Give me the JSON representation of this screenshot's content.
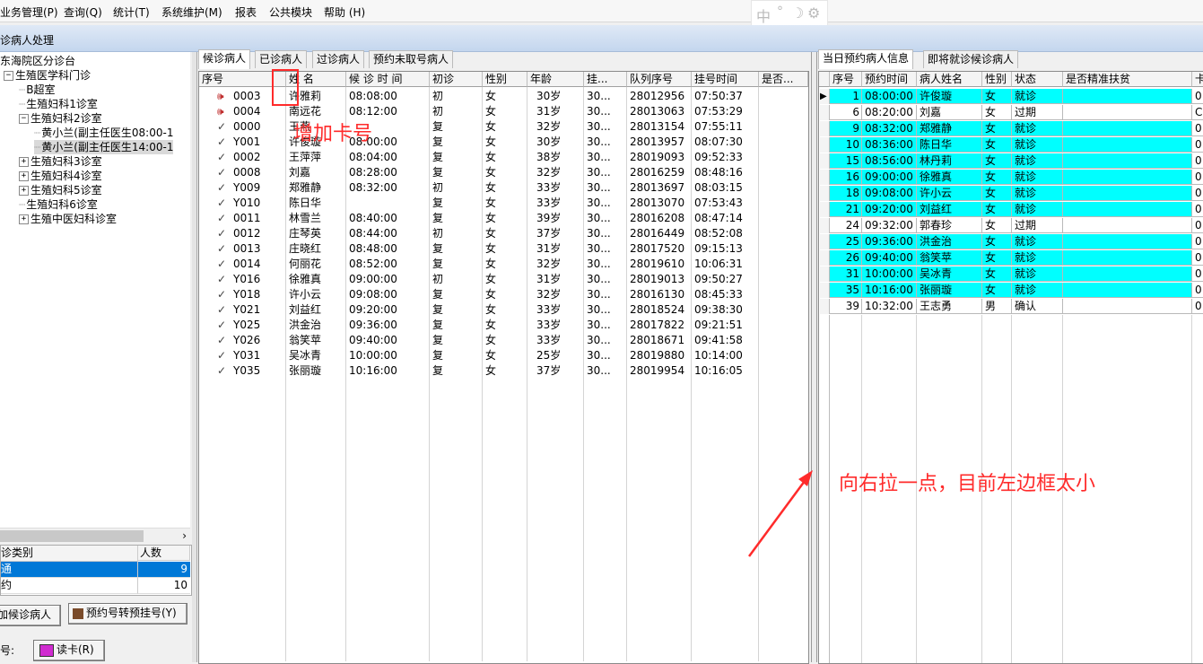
{
  "menu": [
    "业务管理(P)",
    "查询(Q)",
    "统计(T)",
    "系统维护(M)",
    "报表",
    "公共模块",
    "帮助 (H)"
  ],
  "ime": {
    "lang": "中",
    "punct": "°",
    "moon": "☽",
    "gear": "⚙"
  },
  "window_title": "诊病人处理",
  "tree": {
    "root": "东海院区分诊台",
    "nodes": [
      {
        "label": "生殖医学科门诊",
        "expander": "⊟",
        "level": 0
      },
      {
        "label": "B超室",
        "expander": "",
        "level": 1
      },
      {
        "label": "生殖妇科1诊室",
        "expander": "",
        "level": 1
      },
      {
        "label": "生殖妇科2诊室",
        "expander": "⊟",
        "level": 1
      },
      {
        "label": "黄小兰(副主任医生08:00-1",
        "expander": "",
        "level": 2
      },
      {
        "label": "黄小兰(副主任医生14:00-1",
        "expander": "",
        "level": 2,
        "selected": true
      },
      {
        "label": "生殖妇科3诊室",
        "expander": "⊞",
        "level": 1
      },
      {
        "label": "生殖妇科4诊室",
        "expander": "⊞",
        "level": 1
      },
      {
        "label": "生殖妇科5诊室",
        "expander": "⊞",
        "level": 1
      },
      {
        "label": "生殖妇科6诊室",
        "expander": "",
        "level": 1
      },
      {
        "label": "生殖中医妇科诊室",
        "expander": "⊞",
        "level": 1
      }
    ]
  },
  "type_table": {
    "headers": [
      "诊类别",
      "人数"
    ],
    "rows": [
      {
        "type": "通",
        "count": "9",
        "selected": true
      },
      {
        "type": "约",
        "count": "10",
        "selected": false
      }
    ]
  },
  "buttons": {
    "add_waiting": "加候诊病人",
    "convert": "预约号转预挂号(Y)",
    "card_label": "号:",
    "read_card": "读卡(R)"
  },
  "left_tabs": [
    "候诊病人",
    "已诊病人",
    "过诊病人",
    "预约未取号病人"
  ],
  "left_grid": {
    "headers": [
      "序号",
      "姓 名",
      "候 诊 时 间",
      "初诊",
      "性别",
      "年龄",
      "挂...",
      "队列序号",
      "挂号时间",
      "是否..."
    ],
    "rows": [
      {
        "icon": "speaker",
        "no": "0003",
        "name": "许雅莉",
        "time": "08:08:00",
        "first": "初",
        "sex": "女",
        "age": "30岁",
        "g": "30...",
        "queue": "28012956",
        "reg": "07:50:37"
      },
      {
        "icon": "speaker",
        "no": "0004",
        "name": "南远花",
        "time": "08:12:00",
        "first": "初",
        "sex": "女",
        "age": "31岁",
        "g": "30...",
        "queue": "28013063",
        "reg": "07:53:29"
      },
      {
        "icon": "check",
        "no": "0000",
        "name": "王燕",
        "time": "",
        "first": "复",
        "sex": "女",
        "age": "32岁",
        "g": "30...",
        "queue": "28013154",
        "reg": "07:55:11"
      },
      {
        "icon": "check",
        "no": "Y001",
        "name": "许俊璇",
        "time": "08:00:00",
        "first": "复",
        "sex": "女",
        "age": "30岁",
        "g": "30...",
        "queue": "28013957",
        "reg": "08:07:30"
      },
      {
        "icon": "check",
        "no": "0002",
        "name": "王萍萍",
        "time": "08:04:00",
        "first": "复",
        "sex": "女",
        "age": "38岁",
        "g": "30...",
        "queue": "28019093",
        "reg": "09:52:33"
      },
      {
        "icon": "check",
        "no": "0008",
        "name": "刘嘉",
        "time": "08:28:00",
        "first": "复",
        "sex": "女",
        "age": "32岁",
        "g": "30...",
        "queue": "28016259",
        "reg": "08:48:16"
      },
      {
        "icon": "check",
        "no": "Y009",
        "name": "郑雅静",
        "time": "08:32:00",
        "first": "初",
        "sex": "女",
        "age": "33岁",
        "g": "30...",
        "queue": "28013697",
        "reg": "08:03:15"
      },
      {
        "icon": "check",
        "no": "Y010",
        "name": "陈日华",
        "time": "",
        "first": "复",
        "sex": "女",
        "age": "33岁",
        "g": "30...",
        "queue": "28013070",
        "reg": "07:53:43"
      },
      {
        "icon": "check",
        "no": "0011",
        "name": "林雪兰",
        "time": "08:40:00",
        "first": "复",
        "sex": "女",
        "age": "39岁",
        "g": "30...",
        "queue": "28016208",
        "reg": "08:47:14"
      },
      {
        "icon": "check",
        "no": "0012",
        "name": "庄琴英",
        "time": "08:44:00",
        "first": "初",
        "sex": "女",
        "age": "37岁",
        "g": "30...",
        "queue": "28016449",
        "reg": "08:52:08"
      },
      {
        "icon": "check",
        "no": "0013",
        "name": "庄晓红",
        "time": "08:48:00",
        "first": "复",
        "sex": "女",
        "age": "31岁",
        "g": "30...",
        "queue": "28017520",
        "reg": "09:15:13"
      },
      {
        "icon": "check",
        "no": "0014",
        "name": "何丽花",
        "time": "08:52:00",
        "first": "复",
        "sex": "女",
        "age": "32岁",
        "g": "30...",
        "queue": "28019610",
        "reg": "10:06:31"
      },
      {
        "icon": "check",
        "no": "Y016",
        "name": "徐雅真",
        "time": "09:00:00",
        "first": "初",
        "sex": "女",
        "age": "31岁",
        "g": "30...",
        "queue": "28019013",
        "reg": "09:50:27"
      },
      {
        "icon": "check",
        "no": "Y018",
        "name": "许小云",
        "time": "09:08:00",
        "first": "复",
        "sex": "女",
        "age": "32岁",
        "g": "30...",
        "queue": "28016130",
        "reg": "08:45:33"
      },
      {
        "icon": "check",
        "no": "Y021",
        "name": "刘益红",
        "time": "09:20:00",
        "first": "复",
        "sex": "女",
        "age": "33岁",
        "g": "30...",
        "queue": "28018524",
        "reg": "09:38:30"
      },
      {
        "icon": "check",
        "no": "Y025",
        "name": "洪金治",
        "time": "09:36:00",
        "first": "复",
        "sex": "女",
        "age": "33岁",
        "g": "30...",
        "queue": "28017822",
        "reg": "09:21:51"
      },
      {
        "icon": "check",
        "no": "Y026",
        "name": "翁笑苹",
        "time": "09:40:00",
        "first": "复",
        "sex": "女",
        "age": "33岁",
        "g": "30...",
        "queue": "28018671",
        "reg": "09:41:58"
      },
      {
        "icon": "check",
        "no": "Y031",
        "name": "吴冰青",
        "time": "10:00:00",
        "first": "复",
        "sex": "女",
        "age": "25岁",
        "g": "30...",
        "queue": "28019880",
        "reg": "10:14:00"
      },
      {
        "icon": "check",
        "no": "Y035",
        "name": "张丽璇",
        "time": "10:16:00",
        "first": "复",
        "sex": "女",
        "age": "37岁",
        "g": "30...",
        "queue": "28019954",
        "reg": "10:16:05"
      }
    ]
  },
  "right_tabs": [
    "当日预约病人信息",
    "即将就诊候诊病人"
  ],
  "right_grid": {
    "headers": [
      "序号",
      "预约时间",
      "病人姓名",
      "性别",
      "状态",
      "是否精准扶贫",
      "卡"
    ],
    "rows": [
      {
        "no": "1",
        "time": "08:00:00",
        "name": "许俊璇",
        "sex": "女",
        "status": "就诊",
        "poor": "",
        "card": "0",
        "hl": true,
        "current": true
      },
      {
        "no": "6",
        "time": "08:20:00",
        "name": "刘嘉",
        "sex": "女",
        "status": "过期",
        "poor": "",
        "card": "C:",
        "hl": false
      },
      {
        "no": "9",
        "time": "08:32:00",
        "name": "郑雅静",
        "sex": "女",
        "status": "就诊",
        "poor": "",
        "card": "0",
        "hl": true
      },
      {
        "no": "10",
        "time": "08:36:00",
        "name": "陈日华",
        "sex": "女",
        "status": "就诊",
        "poor": "",
        "card": "0",
        "hl": true
      },
      {
        "no": "15",
        "time": "08:56:00",
        "name": "林丹莉",
        "sex": "女",
        "status": "就诊",
        "poor": "",
        "card": "0",
        "hl": true
      },
      {
        "no": "16",
        "time": "09:00:00",
        "name": "徐雅真",
        "sex": "女",
        "status": "就诊",
        "poor": "",
        "card": "0",
        "hl": true
      },
      {
        "no": "18",
        "time": "09:08:00",
        "name": "许小云",
        "sex": "女",
        "status": "就诊",
        "poor": "",
        "card": "0",
        "hl": true
      },
      {
        "no": "21",
        "time": "09:20:00",
        "name": "刘益红",
        "sex": "女",
        "status": "就诊",
        "poor": "",
        "card": "0",
        "hl": true
      },
      {
        "no": "24",
        "time": "09:32:00",
        "name": "郭春珍",
        "sex": "女",
        "status": "过期",
        "poor": "",
        "card": "0",
        "hl": false
      },
      {
        "no": "25",
        "time": "09:36:00",
        "name": "洪金治",
        "sex": "女",
        "status": "就诊",
        "poor": "",
        "card": "0:",
        "hl": true
      },
      {
        "no": "26",
        "time": "09:40:00",
        "name": "翁笑苹",
        "sex": "女",
        "status": "就诊",
        "poor": "",
        "card": "0",
        "hl": true
      },
      {
        "no": "31",
        "time": "10:00:00",
        "name": "吴冰青",
        "sex": "女",
        "status": "就诊",
        "poor": "",
        "card": "0:",
        "hl": true
      },
      {
        "no": "35",
        "time": "10:16:00",
        "name": "张丽璇",
        "sex": "女",
        "status": "就诊",
        "poor": "",
        "card": "0",
        "hl": true
      },
      {
        "no": "39",
        "time": "10:32:00",
        "name": "王志勇",
        "sex": "男",
        "status": "确认",
        "poor": "",
        "card": "0",
        "hl": false
      }
    ]
  },
  "annotations": {
    "add_card": "增加卡号",
    "drag_note": "向右拉一点，目前左边框太小"
  },
  "colors": {
    "highlight": "#00ffff",
    "annotation": "#ff2b2b",
    "selection": "#0078d7"
  }
}
